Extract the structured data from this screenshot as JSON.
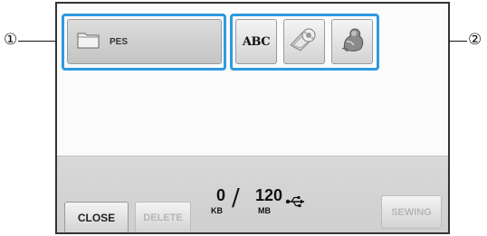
{
  "callouts": {
    "left": "①",
    "right": "②"
  },
  "location_button": {
    "label": "PES",
    "icon": "folder-icon"
  },
  "pattern_buttons": [
    {
      "label": "ABC",
      "icon": "abc-text-icon"
    },
    {
      "label": "",
      "icon": "flower-disk-icon"
    },
    {
      "label": "",
      "icon": "cat-design-icon"
    }
  ],
  "footer": {
    "close_label": "CLOSE",
    "delete_label": "DELETE",
    "sewing_label": "SEWING",
    "used_value": "0",
    "used_unit": "KB",
    "separator": "/",
    "capacity_value": "120",
    "capacity_unit": "MB",
    "usb_icon": "usb-icon"
  },
  "colors": {
    "selection_highlight": "#2e9ae0",
    "panel_background": "#fbfbfb",
    "footer_background": "#d4d4d4"
  }
}
